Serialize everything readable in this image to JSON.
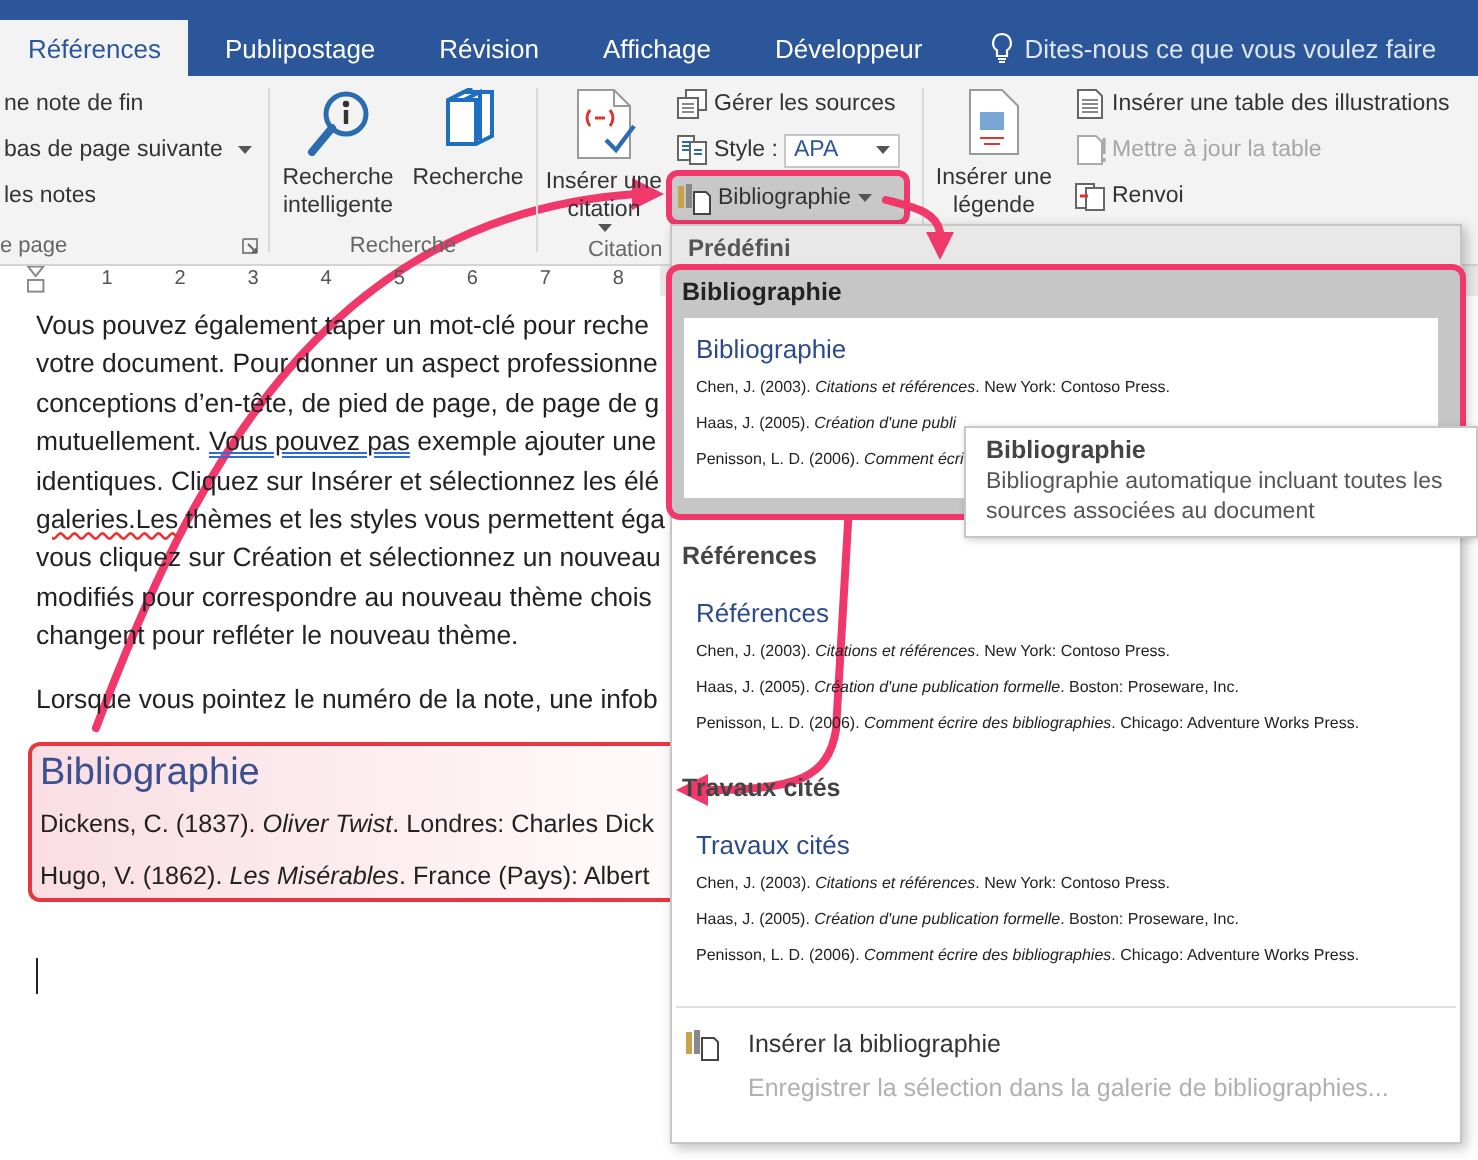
{
  "ribbon_tabs": [
    {
      "label": "Références",
      "selected": true
    },
    {
      "label": "Publipostage",
      "selected": false
    },
    {
      "label": "Révision",
      "selected": false
    },
    {
      "label": "Affichage",
      "selected": false
    },
    {
      "label": "Développeur",
      "selected": false
    }
  ],
  "tell_me": {
    "placeholder": "Dites-nous ce que vous voulez faire"
  },
  "ribbon": {
    "footnotes_group": {
      "items": [
        {
          "label": "ne note de fin",
          "dropdown": false
        },
        {
          "label": "bas de page suivante",
          "dropdown": true
        },
        {
          "label": "les notes",
          "dropdown": false
        }
      ],
      "label": "e page"
    },
    "research_group": {
      "buttons": [
        "Recherche intelligente",
        "Recherche"
      ],
      "label": "Recherche"
    },
    "citations_group": {
      "insert_citation": "Insérer une citation",
      "manage_sources": "Gérer les sources",
      "style_label": "Style :",
      "style_value": "APA",
      "bibliography_button": {
        "label": "Bibliographie",
        "selected": true
      },
      "label": "Citation"
    },
    "captions_group": {
      "insert_caption": "Insérer une légende",
      "items": [
        {
          "label": "Insérer une table des illustrations",
          "disabled": false
        },
        {
          "label": "Mettre à jour la table",
          "disabled": true
        },
        {
          "label": "Renvoi",
          "disabled": false
        }
      ]
    }
  },
  "ruler": {
    "marks": [
      "1",
      "2",
      "3",
      "4",
      "5",
      "6",
      "7",
      "8"
    ]
  },
  "document": {
    "lines": [
      [
        {
          "text": "Vous pouvez également taper un mot-clé pour reche",
          "kind": "plain"
        }
      ],
      [
        {
          "text": "votre document. Pour donner un aspect professionne",
          "kind": "plain"
        }
      ],
      [
        {
          "text": "conceptions d’en-tête, de pied de page, de page de g",
          "kind": "plain"
        }
      ],
      [
        {
          "text": "mutuellement. ",
          "kind": "plain"
        },
        {
          "text": "Vous pouvez pas",
          "kind": "grammar"
        },
        {
          "text": " exemple ajouter une",
          "kind": "plain"
        }
      ],
      [
        {
          "text": "identiques. Cliquez sur Insérer et sélectionnez les élé",
          "kind": "plain"
        }
      ],
      [
        {
          "text": "galeries.Les",
          "kind": "spelling"
        },
        {
          "text": " thèmes et les styles vous permettent éga",
          "kind": "plain"
        }
      ],
      [
        {
          "text": "vous cliquez sur Création et sélectionnez un nouveau",
          "kind": "plain"
        }
      ],
      [
        {
          "text": "modifiés pour correspondre au nouveau thème chois",
          "kind": "plain"
        }
      ],
      [
        {
          "text": "changent pour refléter le nouveau thème.",
          "kind": "plain"
        }
      ]
    ],
    "paragraph": "Lorsque vous pointez le numéro de la note, une infob",
    "bibliography": {
      "title": "Bibliographie",
      "entries": [
        "Dickens, C. (1837). *Oliver Twist*. Londres: Charles Dick",
        "Hugo, V. (1862). *Les Misérables*. France (Pays): Albert"
      ]
    }
  },
  "bibliography_menu": {
    "header": "Prédéfini",
    "sections": [
      {
        "title": "Bibliographie",
        "selected": true,
        "preview": {
          "heading": "Bibliographie",
          "entries": [
            "Chen, J. (2003). *Citations et références*. New York: Contoso Press.",
            "Haas, J. (2005). *Création d'une publi*",
            "Penisson, L. D. (2006). *Comment écri*"
          ]
        }
      },
      {
        "title": "Références",
        "selected": false,
        "preview": {
          "heading": "Références",
          "entries": [
            "Chen, J. (2003). *Citations et références*. New York: Contoso Press.",
            "Haas, J. (2005). *Création d'une publication formelle*. Boston: Proseware, Inc.",
            "Penisson, L. D. (2006). *Comment écrire des bibliographies*. Chicago: Adventure Works Press."
          ]
        }
      },
      {
        "title": "Travaux cités",
        "selected": false,
        "preview": {
          "heading": "Travaux cités",
          "entries": [
            "Chen, J. (2003). *Citations et références*. New York: Contoso Press.",
            "Haas, J. (2005). *Création d'une publication formelle*. Boston: Proseware, Inc.",
            "Penisson, L. D. (2006). *Comment écrire des bibliographies*. Chicago: Adventure Works Press."
          ]
        }
      }
    ],
    "commands": [
      {
        "label": "Insérer la bibliographie",
        "disabled": false
      },
      {
        "label": "Enregistrer la sélection dans la galerie de bibliographies...",
        "disabled": true
      }
    ]
  },
  "tooltip": {
    "title": "Bibliographie",
    "text": "Bibliographie automatique incluant toutes les sources associées au document"
  }
}
